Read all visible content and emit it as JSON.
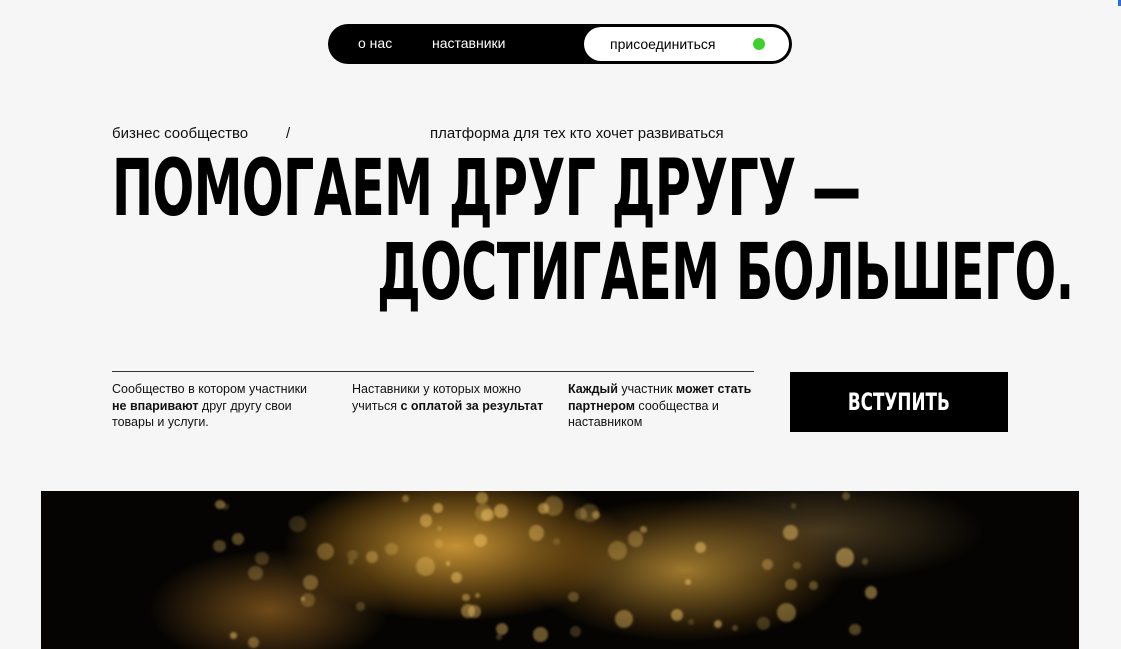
{
  "nav": {
    "about": "о нас",
    "mentors": "наставники",
    "join": "присоединиться",
    "status_color": "#3ecf2c"
  },
  "breadcrumb": {
    "first": "бизнес сообщество",
    "separator": "/",
    "second": "платформа для тех кто хочет развиваться"
  },
  "headline": {
    "line1": "ПОМОГАЕМ ДРУГ ДРУГУ —",
    "line2": "ДОСТИГАЕМ БОЛЬШЕГО."
  },
  "features": [
    {
      "p1": "Сообщество в котором участники",
      "b1": "не впаривают",
      "p2": " друг другу свои товары и услуги."
    },
    {
      "p1": "Наставники у которых можно учиться ",
      "b1": "с оплатой за результат",
      "p2": ""
    },
    {
      "b1": "Каждый",
      "p1": " участник ",
      "b2": "может стать партнером",
      "p2": " сообщества и наставником"
    }
  ],
  "cta": {
    "label": "ВСТУПИТЬ"
  },
  "hero": {
    "icon": "golden-bokeh-image"
  }
}
